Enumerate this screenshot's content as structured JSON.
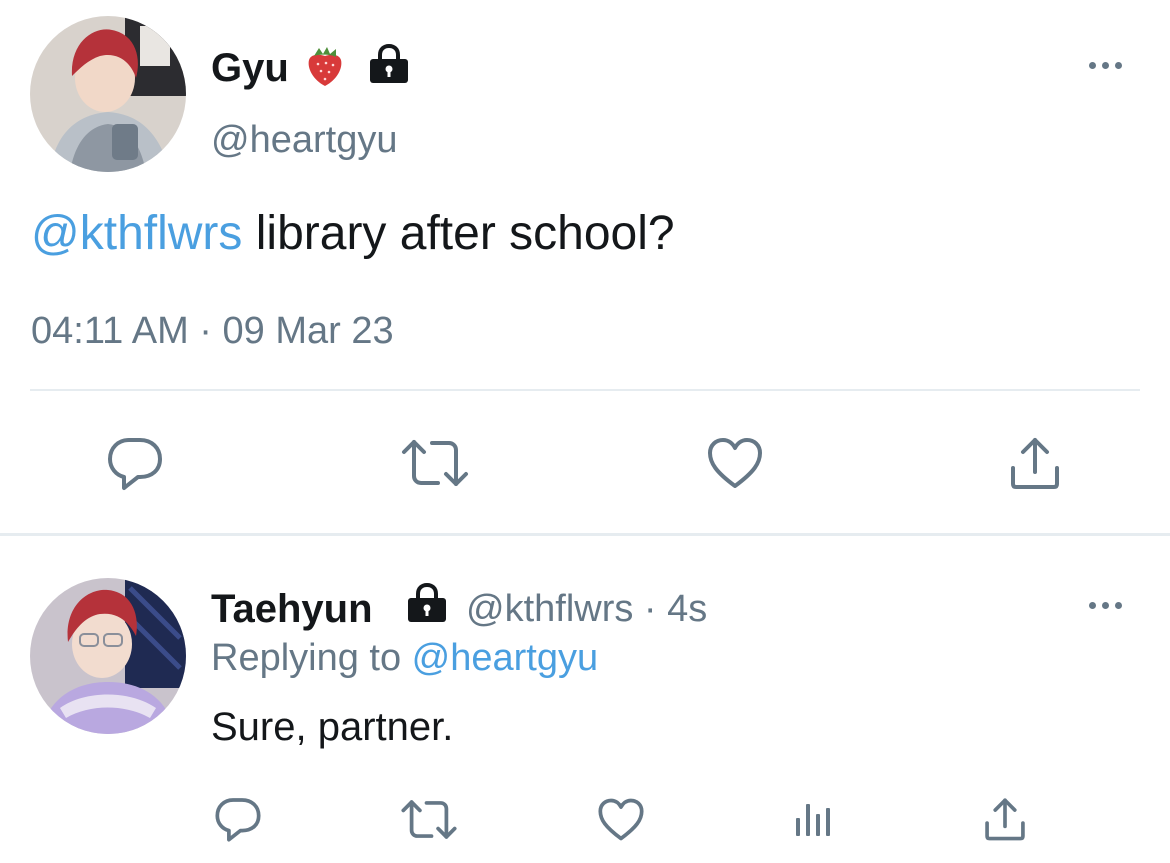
{
  "tweet": {
    "author_name": "Gyu",
    "author_emoji": "🍓",
    "author_handle": "@heartgyu",
    "mention": "@kthflwrs",
    "text": " library after school?",
    "timestamp": "04:11 AM · 09 Mar 23",
    "actions": [
      "reply-icon",
      "retweet-icon",
      "like-icon",
      "share-icon"
    ]
  },
  "reply": {
    "author_name": "Taehyun",
    "author_handle": "@kthflwrs",
    "time_sep": " · ",
    "time": "4s",
    "replying_prefix": "Replying to ",
    "replying_handle": "@heartgyu",
    "text": "Sure, partner.",
    "actions": [
      "reply-icon",
      "retweet-icon",
      "like-icon",
      "analytics-icon",
      "share-icon"
    ]
  },
  "colors": {
    "text": "#14171a",
    "muted": "#657786",
    "link": "#4a9fe0",
    "divider": "#e6ecf0"
  }
}
